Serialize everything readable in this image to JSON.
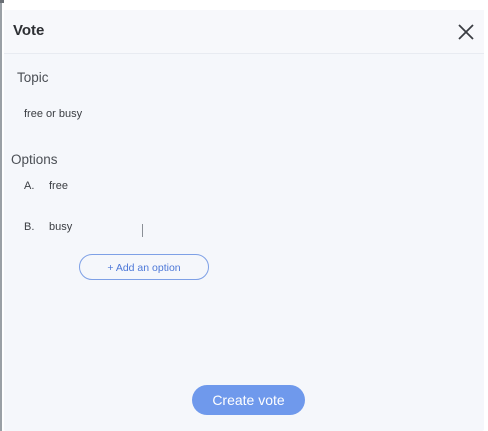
{
  "dialog": {
    "title": "Vote",
    "close_icon": "close-icon"
  },
  "topic": {
    "label": "Topic",
    "value": "free or busy"
  },
  "options": {
    "label": "Options",
    "items": [
      {
        "letter": "A.",
        "value": "free"
      },
      {
        "letter": "B.",
        "value": "busy"
      }
    ],
    "add_label": "+ Add an option"
  },
  "actions": {
    "create_label": "Create vote"
  },
  "colors": {
    "accent": "#6f99ec",
    "accent_text": "#4d78d8",
    "background": "#f5f7fb",
    "text": "#3a3d42"
  }
}
